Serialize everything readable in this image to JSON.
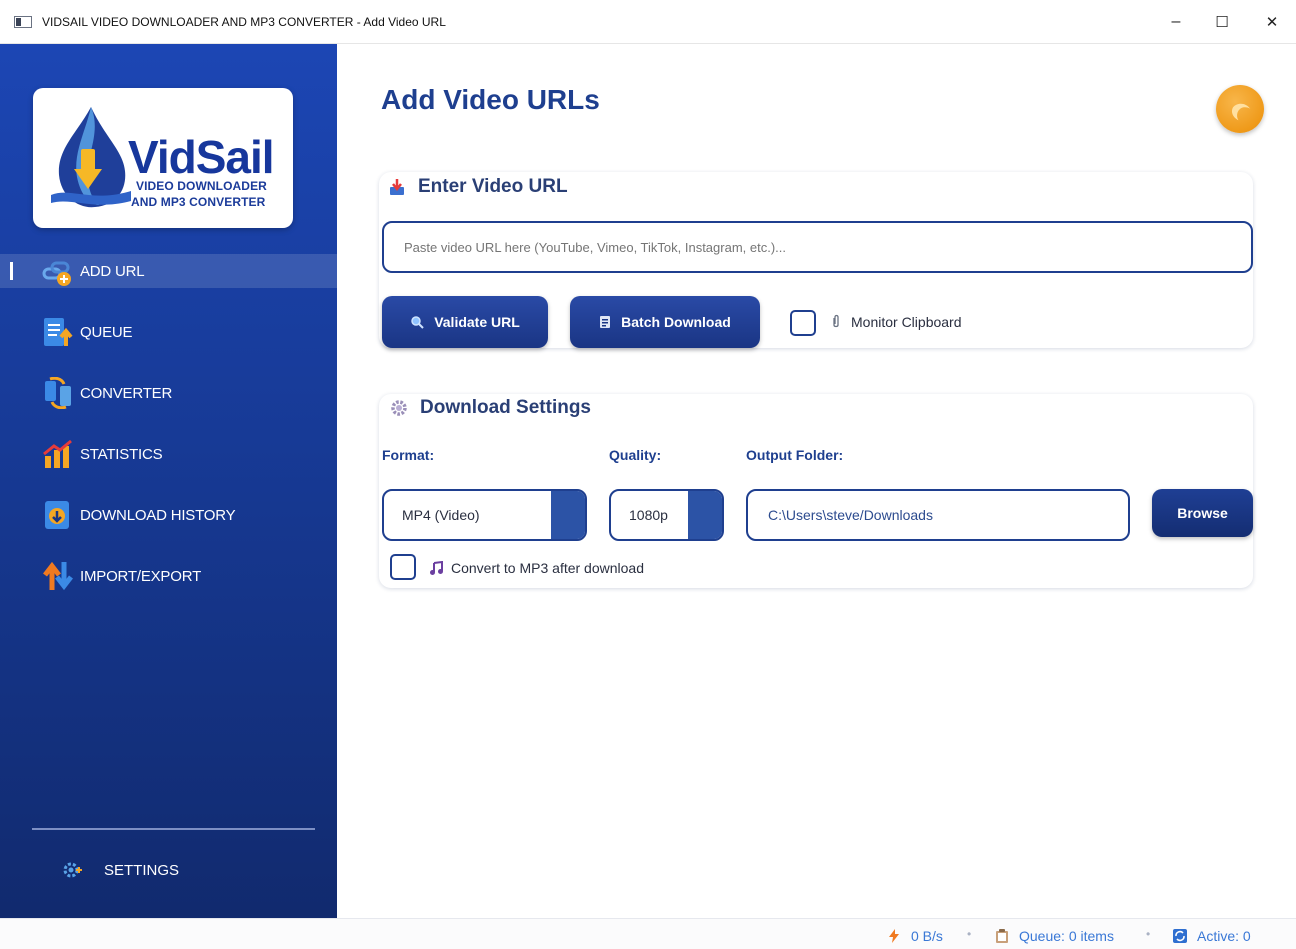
{
  "window": {
    "title": "VIDSAIL VIDEO DOWNLOADER AND MP3 CONVERTER - Add Video URL",
    "controls": {
      "minimize": "–",
      "maximize": "☐",
      "close": "✕"
    }
  },
  "logo": {
    "name": "VidSail",
    "line1": "VIDEO DOWNLOADER",
    "line2": "AND MP3 CONVERTER"
  },
  "sidebar": {
    "items": [
      {
        "label": "ADD URL",
        "icon": "add-url-icon",
        "active": true
      },
      {
        "label": "QUEUE",
        "icon": "queue-icon",
        "active": false
      },
      {
        "label": "CONVERTER",
        "icon": "converter-icon",
        "active": false
      },
      {
        "label": "STATISTICS",
        "icon": "statistics-icon",
        "active": false
      },
      {
        "label": "DOWNLOAD HISTORY",
        "icon": "download-history-icon",
        "active": false
      },
      {
        "label": "IMPORT/EXPORT",
        "icon": "import-export-icon",
        "active": false
      }
    ],
    "settings_label": "SETTINGS"
  },
  "main": {
    "title": "Add Video URLs",
    "url_section": {
      "title": "Enter Video URL",
      "placeholder": "Paste video URL here (YouTube, Vimeo, TikTok, Instagram, etc.)...",
      "validate_label": "Validate URL",
      "batch_label": "Batch Download",
      "monitor_label": "Monitor Clipboard",
      "monitor_checked": false
    },
    "settings_section": {
      "title": "Download Settings",
      "format_label": "Format:",
      "format_value": "MP4 (Video)",
      "quality_label": "Quality:",
      "quality_value": "1080p",
      "output_label": "Output Folder:",
      "output_value": "C:\\Users\\steve/Downloads",
      "browse_label": "Browse",
      "convert_label": "Convert to MP3 after download",
      "convert_checked": false
    }
  },
  "status": {
    "speed": "0 B/s",
    "queue": "Queue: 0 items",
    "active": "Active: 0",
    "separator": "•"
  },
  "colors": {
    "accent": "#1e3f8f",
    "sidebar_top": "#1c46b4",
    "sidebar_bottom": "#112a6e",
    "theme_toggle": "#ef9a1a"
  }
}
